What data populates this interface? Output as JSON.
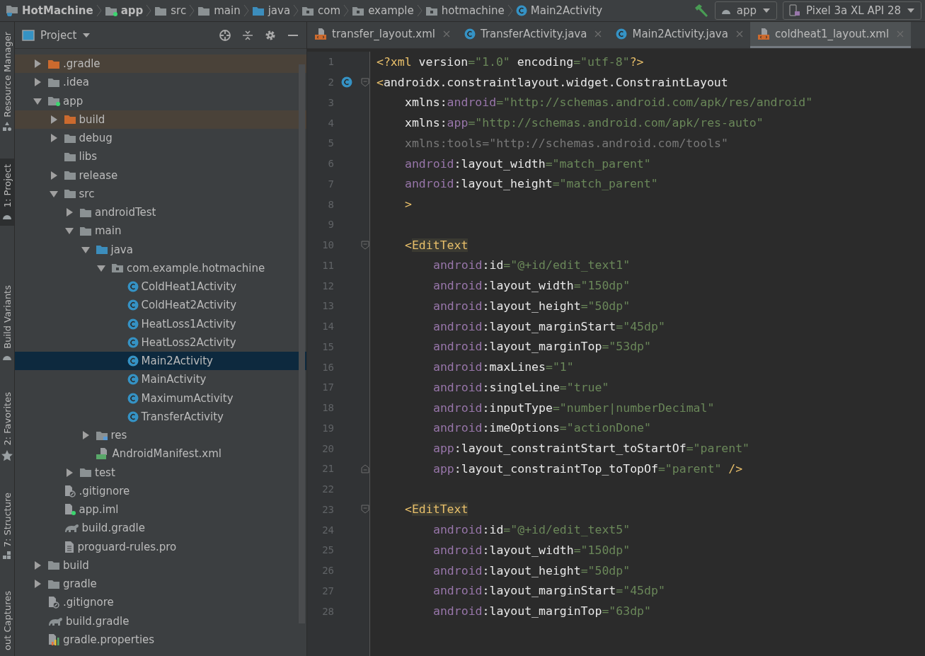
{
  "breadcrumbs": [
    {
      "label": "HotMachine",
      "kind": "project"
    },
    {
      "label": "app",
      "kind": "module"
    },
    {
      "label": "src",
      "kind": "folder"
    },
    {
      "label": "main",
      "kind": "folder"
    },
    {
      "label": "java",
      "kind": "source_folder"
    },
    {
      "label": "com",
      "kind": "package"
    },
    {
      "label": "example",
      "kind": "package"
    },
    {
      "label": "hotmachine",
      "kind": "package"
    },
    {
      "label": "Main2Activity",
      "kind": "class"
    }
  ],
  "run_config": {
    "module": "app",
    "device": "Pixel 3a XL API 28"
  },
  "side_tabs_top": [
    {
      "label": "Resource Manager",
      "kind": "shapes",
      "selected": false
    },
    {
      "label": "1: Project",
      "kind": "android",
      "selected": true
    }
  ],
  "side_tabs_bottom": [
    {
      "label": "Build Variants",
      "kind": "android",
      "selected": false
    },
    {
      "label": "2: Favorites",
      "kind": "star",
      "selected": false
    },
    {
      "label": "7: Structure",
      "kind": "structure",
      "selected": false
    },
    {
      "label": "out Captures",
      "kind": "none",
      "selected": false
    }
  ],
  "project_panel": {
    "title": "Project"
  },
  "tree": [
    {
      "label": ".gradle",
      "kind": "excluded_folder",
      "expanded": false,
      "selected": false
    },
    {
      "label": ".idea",
      "kind": "folder",
      "expanded": false,
      "selected": false
    },
    {
      "label": "app",
      "kind": "module",
      "expanded": true,
      "selected": false,
      "children": [
        {
          "label": "build",
          "kind": "excluded_folder",
          "expanded": false,
          "selected": false
        },
        {
          "label": "debug",
          "kind": "folder",
          "expanded": false,
          "selected": false
        },
        {
          "label": "libs",
          "kind": "folder",
          "selected": false
        },
        {
          "label": "release",
          "kind": "folder",
          "expanded": false,
          "selected": false
        },
        {
          "label": "src",
          "kind": "folder",
          "expanded": true,
          "selected": false,
          "children": [
            {
              "label": "androidTest",
              "kind": "folder",
              "expanded": false,
              "selected": false
            },
            {
              "label": "main",
              "kind": "folder",
              "expanded": true,
              "selected": false,
              "children": [
                {
                  "label": "java",
                  "kind": "source_folder",
                  "expanded": true,
                  "selected": false,
                  "children": [
                    {
                      "label": "com.example.hotmachine",
                      "kind": "package",
                      "expanded": true,
                      "selected": false,
                      "children": [
                        {
                          "label": "ColdHeat1Activity",
                          "kind": "class",
                          "selected": false
                        },
                        {
                          "label": "ColdHeat2Activity",
                          "kind": "class",
                          "selected": false
                        },
                        {
                          "label": "HeatLoss1Activity",
                          "kind": "class",
                          "selected": false
                        },
                        {
                          "label": "HeatLoss2Activity",
                          "kind": "class",
                          "selected": false
                        },
                        {
                          "label": "Main2Activity",
                          "kind": "class",
                          "selected": true
                        },
                        {
                          "label": "MainActivity",
                          "kind": "class",
                          "selected": false
                        },
                        {
                          "label": "MaximumActivity",
                          "kind": "class",
                          "selected": false
                        },
                        {
                          "label": "TransferActivity",
                          "kind": "class",
                          "selected": false
                        }
                      ]
                    }
                  ]
                },
                {
                  "label": "res",
                  "kind": "res_folder",
                  "expanded": false,
                  "selected": false
                },
                {
                  "label": "AndroidManifest.xml",
                  "kind": "manifest",
                  "selected": false
                }
              ]
            },
            {
              "label": "test",
              "kind": "folder",
              "expanded": false,
              "selected": false
            }
          ]
        },
        {
          "label": ".gitignore",
          "kind": "gitignore",
          "selected": false
        },
        {
          "label": "app.iml",
          "kind": "iml",
          "selected": false
        },
        {
          "label": "build.gradle",
          "kind": "gradle",
          "selected": false
        },
        {
          "label": "proguard-rules.pro",
          "kind": "file",
          "selected": false
        }
      ]
    },
    {
      "label": "build",
      "kind": "folder",
      "expanded": false,
      "selected": false
    },
    {
      "label": "gradle",
      "kind": "folder",
      "expanded": false,
      "selected": false
    },
    {
      "label": ".gitignore",
      "kind": "gitignore",
      "selected": false
    },
    {
      "label": "build.gradle",
      "kind": "gradle",
      "selected": false
    },
    {
      "label": "gradle.properties",
      "kind": "properties",
      "selected": false
    }
  ],
  "tabs": [
    {
      "label": "transfer_layout.xml",
      "kind": "xml",
      "selected": false
    },
    {
      "label": "TransferActivity.java",
      "kind": "class",
      "selected": false
    },
    {
      "label": "Main2Activity.java",
      "kind": "class",
      "selected": false
    },
    {
      "label": "coldheat1_layout.xml",
      "kind": "xml",
      "selected": true
    }
  ],
  "code_lines": [
    {
      "number": "1",
      "kind": "plain",
      "segments": [
        {
          "kind": "punct",
          "text": "<?xml"
        },
        {
          "kind": "name",
          "text": " version"
        },
        {
          "kind": "value",
          "text": "=\"1.0\""
        },
        {
          "kind": "name",
          "text": " encoding"
        },
        {
          "kind": "value",
          "text": "=\"utf-8\""
        },
        {
          "kind": "punct",
          "text": "?>"
        }
      ]
    },
    {
      "number": "2",
      "kind": "class_fold_start",
      "segments": [
        {
          "kind": "punct",
          "text": "<"
        },
        {
          "kind": "name",
          "text": "androidx.constraintlayout.widget.ConstraintLayout"
        }
      ],
      "children": [
        {
          "number": "3",
          "kind": "plain",
          "segments": [
            {
              "kind": "name",
              "text": "xmlns:"
            },
            {
              "kind": "ns",
              "text": "android"
            },
            {
              "kind": "value",
              "text": "=\"http://schemas.android.com/apk/res/android\""
            }
          ]
        },
        {
          "number": "4",
          "kind": "plain",
          "segments": [
            {
              "kind": "name",
              "text": "xmlns:"
            },
            {
              "kind": "ns",
              "text": "app"
            },
            {
              "kind": "value",
              "text": "=\"http://schemas.android.com/apk/res-auto\""
            }
          ]
        },
        {
          "number": "5",
          "kind": "plain",
          "segments": [
            {
              "kind": "dim",
              "text": "xmlns:tools=\"http://schemas.android.com/tools\""
            }
          ]
        },
        {
          "number": "6",
          "kind": "plain",
          "segments": [
            {
              "kind": "ns",
              "text": "android"
            },
            {
              "kind": "name",
              "text": ":layout_width"
            },
            {
              "kind": "value",
              "text": "=\"match_parent\""
            }
          ]
        },
        {
          "number": "7",
          "kind": "plain",
          "segments": [
            {
              "kind": "ns",
              "text": "android"
            },
            {
              "kind": "name",
              "text": ":layout_height"
            },
            {
              "kind": "value",
              "text": "=\"match_parent\""
            }
          ]
        },
        {
          "number": "8",
          "kind": "plain",
          "segments": [
            {
              "kind": "punct",
              "text": ">"
            }
          ]
        },
        {
          "number": "9",
          "kind": "plain"
        },
        {
          "number": "10",
          "kind": "fold_start",
          "segments": [
            {
              "kind": "punct",
              "text": "<"
            },
            {
              "kind": "tag",
              "text": "EditText"
            }
          ],
          "children": [
            {
              "number": "11",
              "kind": "plain",
              "segments": [
                {
                  "kind": "ns",
                  "text": "android"
                },
                {
                  "kind": "name",
                  "text": ":id"
                },
                {
                  "kind": "value",
                  "text": "=\"@+id/edit_text1\""
                }
              ]
            },
            {
              "number": "12",
              "kind": "plain",
              "segments": [
                {
                  "kind": "ns",
                  "text": "android"
                },
                {
                  "kind": "name",
                  "text": ":layout_width"
                },
                {
                  "kind": "value",
                  "text": "=\"150dp\""
                }
              ]
            },
            {
              "number": "13",
              "kind": "plain",
              "segments": [
                {
                  "kind": "ns",
                  "text": "android"
                },
                {
                  "kind": "name",
                  "text": ":layout_height"
                },
                {
                  "kind": "value",
                  "text": "=\"50dp\""
                }
              ]
            },
            {
              "number": "14",
              "kind": "plain",
              "segments": [
                {
                  "kind": "ns",
                  "text": "android"
                },
                {
                  "kind": "name",
                  "text": ":layout_marginStart"
                },
                {
                  "kind": "value",
                  "text": "=\"45dp\""
                }
              ]
            },
            {
              "number": "15",
              "kind": "plain",
              "segments": [
                {
                  "kind": "ns",
                  "text": "android"
                },
                {
                  "kind": "name",
                  "text": ":layout_marginTop"
                },
                {
                  "kind": "value",
                  "text": "=\"53dp\""
                }
              ]
            },
            {
              "number": "16",
              "kind": "plain",
              "segments": [
                {
                  "kind": "ns",
                  "text": "android"
                },
                {
                  "kind": "name",
                  "text": ":maxLines"
                },
                {
                  "kind": "value",
                  "text": "=\"1\""
                }
              ]
            },
            {
              "number": "17",
              "kind": "plain",
              "segments": [
                {
                  "kind": "ns",
                  "text": "android"
                },
                {
                  "kind": "name",
                  "text": ":singleLine"
                },
                {
                  "kind": "value",
                  "text": "=\"true\""
                }
              ]
            },
            {
              "number": "18",
              "kind": "plain",
              "segments": [
                {
                  "kind": "ns",
                  "text": "android"
                },
                {
                  "kind": "name",
                  "text": ":inputType"
                },
                {
                  "kind": "value",
                  "text": "=\"number|numberDecimal\""
                }
              ]
            },
            {
              "number": "19",
              "kind": "plain",
              "segments": [
                {
                  "kind": "ns",
                  "text": "android"
                },
                {
                  "kind": "name",
                  "text": ":imeOptions"
                },
                {
                  "kind": "value",
                  "text": "=\"actionDone\""
                }
              ]
            },
            {
              "number": "20",
              "kind": "plain",
              "segments": [
                {
                  "kind": "ns",
                  "text": "app"
                },
                {
                  "kind": "name",
                  "text": ":layout_constraintStart_toStartOf"
                },
                {
                  "kind": "value",
                  "text": "=\"parent\""
                }
              ]
            },
            {
              "number": "21",
              "kind": "fold_end",
              "segments": [
                {
                  "kind": "ns",
                  "text": "app"
                },
                {
                  "kind": "name",
                  "text": ":layout_constraintTop_toTopOf"
                },
                {
                  "kind": "value",
                  "text": "=\"parent\""
                },
                {
                  "kind": "punct",
                  "text": " />"
                }
              ]
            }
          ]
        },
        {
          "number": "22",
          "kind": "plain"
        },
        {
          "number": "23",
          "kind": "fold_start",
          "segments": [
            {
              "kind": "punct",
              "text": "<"
            },
            {
              "kind": "tag",
              "text": "EditText"
            }
          ],
          "children": [
            {
              "number": "24",
              "kind": "plain",
              "segments": [
                {
                  "kind": "ns",
                  "text": "android"
                },
                {
                  "kind": "name",
                  "text": ":id"
                },
                {
                  "kind": "value",
                  "text": "=\"@+id/edit_text5\""
                }
              ]
            },
            {
              "number": "25",
              "kind": "plain",
              "segments": [
                {
                  "kind": "ns",
                  "text": "android"
                },
                {
                  "kind": "name",
                  "text": ":layout_width"
                },
                {
                  "kind": "value",
                  "text": "=\"150dp\""
                }
              ]
            },
            {
              "number": "26",
              "kind": "plain",
              "segments": [
                {
                  "kind": "ns",
                  "text": "android"
                },
                {
                  "kind": "name",
                  "text": ":layout_height"
                },
                {
                  "kind": "value",
                  "text": "=\"50dp\""
                }
              ]
            },
            {
              "number": "27",
              "kind": "plain",
              "segments": [
                {
                  "kind": "ns",
                  "text": "android"
                },
                {
                  "kind": "name",
                  "text": ":layout_marginStart"
                },
                {
                  "kind": "value",
                  "text": "=\"45dp\""
                }
              ]
            },
            {
              "number": "28",
              "kind": "plain",
              "segments": [
                {
                  "kind": "ns",
                  "text": "android"
                },
                {
                  "kind": "name",
                  "text": ":layout_marginTop"
                },
                {
                  "kind": "value",
                  "text": "=\"63dp\""
                }
              ]
            }
          ]
        }
      ]
    }
  ]
}
